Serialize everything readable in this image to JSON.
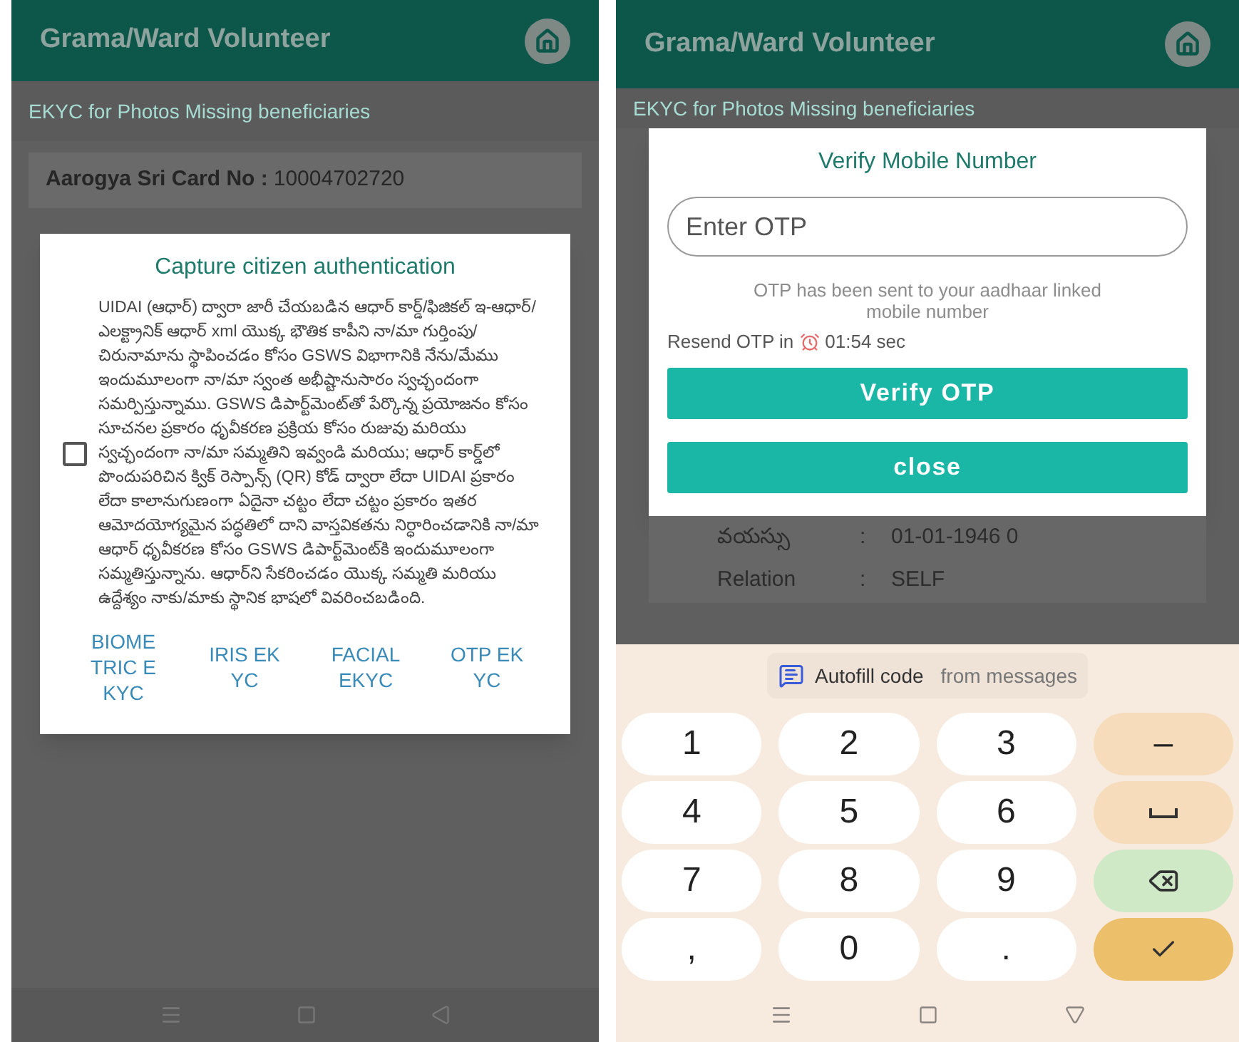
{
  "left_screen": {
    "app_bar": {
      "title": "Grama/Ward Volunteer"
    },
    "page_title": "EKYC for Photos Missing beneficiaries",
    "card": {
      "label": "Aarogya Sri Card No :",
      "value": "10004702720"
    },
    "dialog": {
      "title": "Capture citizen authentication",
      "consent": {
        "checked": false,
        "text": "UIDAI (ఆధార్) ద్వారా జారీ చేయబడిన ఆధార్ కార్డ్/ఫిజికల్ ఇ-ఆధార్/ఎలక్ట్రానిక్ ఆధార్ xml యొక్క భౌతిక కాపీని నా/మా గుర్తింపు/చిరునామాను స్థాపించడం కోసం GSWS విభాగానికి నేను/మేము ఇందుమూలంగా నా/మా స్వంత అభీష్టానుసారం స్వచ్ఛందంగా సమర్పిస్తున్నాము. GSWS డిపార్ట్‌మెంట్‌తో పేర్కొన్న ప్రయోజనం కోసం సూచనల ప్రకారం ధృవీకరణ ప్రక్రియ కోసం రుజువు మరియు స్వచ్ఛందంగా నా/మా సమ్మతిని ఇవ్వండి మరియు; ఆధార్ కార్డ్‌లో పొందుపరిచిన క్విక్ రెస్పాన్స్ (QR) కోడ్ ద్వారా లేదా UIDAI ప్రకారం లేదా కాలానుగుణంగా ఏదైనా చట్టం లేదా చట్టం ప్రకారం ఇతర ఆమోదయోగ్యమైన పద్ధతిలో దాని వాస్తవికతను నిర్ధారించడానికి నా/మా ఆధార్ ధృవీకరణ కోసం GSWS డిపార్ట్‌మెంట్‌కి ఇందుమూలంగా సమ్మతిస్తున్నాను. ఆధార్‌ని సేకరించడం యొక్క సమ్మతి మరియు ఉద్దేశ్యం నాకు/మాకు స్థానిక భాషలో వివరించబడింది."
      },
      "buttons": [
        "BIOMETRIC EKYC",
        "IRIS EKYC",
        "FACIAL EKYC",
        "OTP EKYC"
      ]
    }
  },
  "right_screen": {
    "app_bar": {
      "title": "Grama/Ward Volunteer"
    },
    "page_title": "EKYC for Photos Missing beneficiaries",
    "dialog": {
      "title": "Verify Mobile Number",
      "otp_field": {
        "placeholder": "Enter OTP"
      },
      "message": "OTP has been sent to your aadhaar linked mobile number",
      "resend": {
        "label": "Resend OTP in",
        "timer": "01:54 sec"
      },
      "buttons": [
        "Verify OTP",
        "close"
      ]
    },
    "details": [
      {
        "label": "వయస్సు",
        "separator": ":",
        "value": "01-01-1946 0"
      },
      {
        "label": "Relation",
        "separator": ":",
        "value": "SELF"
      }
    ],
    "keyboard": {
      "suggestion": {
        "title": "Autofill code",
        "source": "from messages"
      },
      "keys": [
        {
          "kind": "char",
          "label": "1"
        },
        {
          "kind": "char",
          "label": "2"
        },
        {
          "kind": "char",
          "label": "3"
        },
        {
          "kind": "minus",
          "label": "–"
        },
        {
          "kind": "char",
          "label": "4"
        },
        {
          "kind": "char",
          "label": "5"
        },
        {
          "kind": "char",
          "label": "6"
        },
        {
          "kind": "space"
        },
        {
          "kind": "char",
          "label": "7"
        },
        {
          "kind": "char",
          "label": "8"
        },
        {
          "kind": "char",
          "label": "9"
        },
        {
          "kind": "backspace"
        },
        {
          "kind": "char",
          "label": ","
        },
        {
          "kind": "char",
          "label": "0"
        },
        {
          "kind": "char",
          "label": "."
        },
        {
          "kind": "enter"
        }
      ]
    }
  }
}
